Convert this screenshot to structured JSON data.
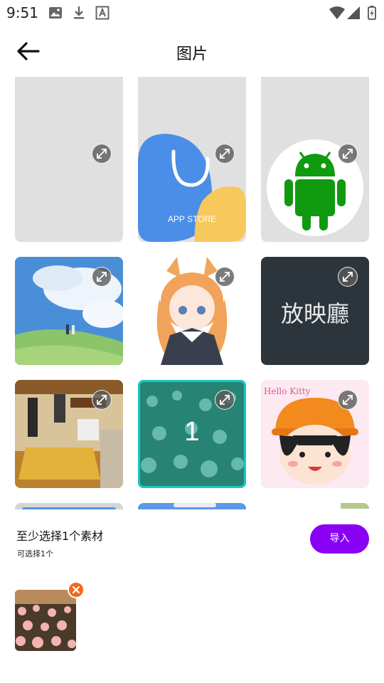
{
  "status_bar": {
    "time": "9:51",
    "left_icons": [
      "image-icon",
      "download-icon",
      "text-a-icon"
    ],
    "right_icons": [
      "wifi-icon",
      "signal-icon",
      "battery-charging-icon"
    ]
  },
  "header": {
    "back_icon": "arrow-left-icon",
    "title": "图片"
  },
  "grid": {
    "columns": 3,
    "items": [
      {
        "name": "blank-photo",
        "selected": false
      },
      {
        "name": "blank-photo",
        "selected": false
      },
      {
        "name": "blank-photo",
        "selected": false
      },
      {
        "name": "blank-photo",
        "selected": false
      },
      {
        "name": "app-store-icon-photo",
        "text": "APP STORE",
        "selected": false
      },
      {
        "name": "android-logo-photo",
        "selected": false
      },
      {
        "name": "sky-landscape-photo",
        "selected": false
      },
      {
        "name": "anime-fox-girl-photo",
        "selected": false
      },
      {
        "name": "text-tile-photo",
        "text": "放映廳",
        "selected": false
      },
      {
        "name": "cafe-interior-photo",
        "selected": false
      },
      {
        "name": "rose-field-photo",
        "selected": true,
        "selection_index": "1"
      },
      {
        "name": "cartoon-girl-photo",
        "text": "Hello Kitty",
        "selected": false
      }
    ],
    "expand_icon": "expand-icon"
  },
  "bottom": {
    "hint_title": "至少选择1个素材",
    "hint_sub": "可选择1个",
    "import_label": "导入",
    "remove_icon": "close-icon"
  },
  "colors": {
    "accent": "#8a00f5",
    "selection": "#17c9c1",
    "remove": "#f26a1b",
    "placeholder": "#e0e0e0"
  }
}
